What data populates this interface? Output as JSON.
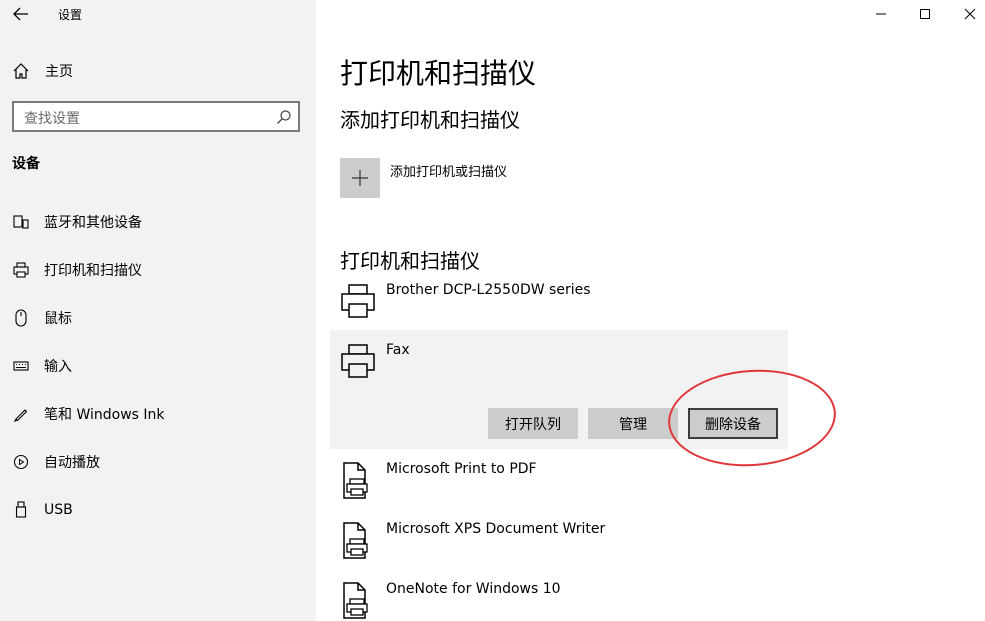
{
  "window": {
    "title": "设置"
  },
  "sidebar": {
    "home_label": "主页",
    "search_placeholder": "查找设置",
    "section_title": "设备",
    "items": [
      {
        "label": "蓝牙和其他设备",
        "icon": "bluetooth-devices-icon"
      },
      {
        "label": "打印机和扫描仪",
        "icon": "printer-icon"
      },
      {
        "label": "鼠标",
        "icon": "mouse-icon"
      },
      {
        "label": "输入",
        "icon": "keyboard-icon"
      },
      {
        "label": "笔和 Windows Ink",
        "icon": "pen-icon"
      },
      {
        "label": "自动播放",
        "icon": "autoplay-icon"
      },
      {
        "label": "USB",
        "icon": "usb-icon"
      }
    ]
  },
  "main": {
    "title": "打印机和扫描仪",
    "add_section_title": "添加打印机和扫描仪",
    "add_label": "添加打印机或扫描仪",
    "list_section_title": "打印机和扫描仪",
    "printers": [
      {
        "name": "Brother DCP-L2550DW series",
        "icon": "printer-icon"
      },
      {
        "name": "Fax",
        "icon": "printer-icon",
        "selected": true
      },
      {
        "name": "Microsoft Print to PDF",
        "icon": "document-printer-icon"
      },
      {
        "name": "Microsoft XPS Document Writer",
        "icon": "document-printer-icon"
      },
      {
        "name": "OneNote for Windows 10",
        "icon": "document-printer-icon"
      }
    ],
    "actions": {
      "open_queue": "打开队列",
      "manage": "管理",
      "remove_device": "删除设备"
    }
  },
  "colors": {
    "sidebar_bg": "#f2f2f2",
    "button_bg": "#cccccc",
    "highlight_circle": "#e0383a"
  }
}
